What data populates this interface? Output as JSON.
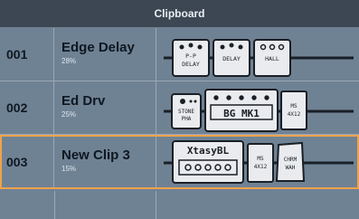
{
  "title": "Clipboard",
  "rows": [
    {
      "number": "001",
      "name": "Edge Delay",
      "percent": "28%",
      "pedals": [
        {
          "type": "stomp",
          "label": "P-P\nDELAY",
          "icon": "pedal-icon"
        },
        {
          "type": "stomp",
          "label": "DELAY",
          "icon": "pedal-icon"
        },
        {
          "type": "stomp",
          "label": "HALL",
          "icon": "pedal-icon"
        }
      ]
    },
    {
      "number": "002",
      "name": "Ed Drv",
      "percent": "25%",
      "pedals": [
        {
          "type": "stomp-small",
          "label": "STONE\nPHA",
          "icon": "pedal-icon"
        },
        {
          "type": "amp",
          "label": "BG MK1",
          "icon": "amp-icon"
        },
        {
          "type": "cab",
          "label": "MS\n4X12",
          "icon": "cabinet-icon"
        }
      ]
    },
    {
      "number": "003",
      "name": "New Clip 3",
      "percent": "15%",
      "pedals": [
        {
          "type": "amp",
          "label": "XtasyBL",
          "icon": "amp-icon"
        },
        {
          "type": "cab",
          "label": "MS\n4X12",
          "icon": "cabinet-icon"
        },
        {
          "type": "wah",
          "label": "CHRM\nWAH",
          "icon": "wah-icon"
        }
      ]
    }
  ],
  "colors": {
    "titlebar": "#3d4753",
    "row": "#6f8294",
    "selected_border": "#f0a24b"
  }
}
